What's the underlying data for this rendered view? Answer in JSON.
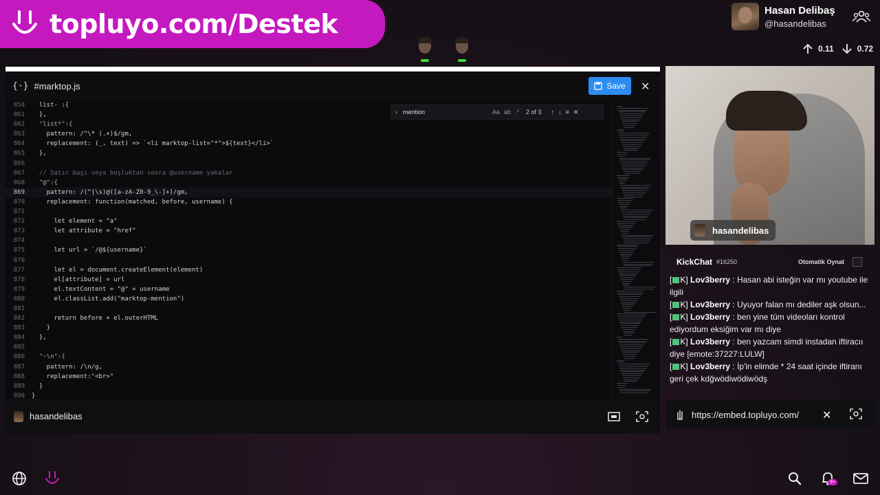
{
  "banner": {
    "text": "topluyo.com/Destek",
    "logo_icon": "topluyo-smile-logo"
  },
  "profile": {
    "name": "Hasan Delibaş",
    "handle": "@hasandelibas"
  },
  "net_stats": {
    "up": "0.11",
    "down": "0.72"
  },
  "editor": {
    "file_icon": "{·}",
    "file_name": "#marktop.js",
    "save_label": "Save",
    "close_label": "✕",
    "footer_name": "hasandelibas",
    "find": {
      "value": "mention",
      "opts": [
        "Aa",
        "ab",
        ".*"
      ],
      "count": "2 of 3"
    },
    "lines": [
      {
        "n": "858",
        "code": "  list- :{",
        "cls": "t-key"
      },
      {
        "n": "861",
        "code": "  },",
        "cls": "t-plain"
      },
      {
        "n": "862",
        "code": "  \"list*\":{",
        "cls": "t-str"
      },
      {
        "n": "863",
        "code": "    pattern: /^\\* (.+)$/gm,",
        "cls": "t-plain"
      },
      {
        "n": "864",
        "code": "    replacement: (_, text) => `<li marktop-list=\"*\">${text}</li>`",
        "cls": "t-plain"
      },
      {
        "n": "865",
        "code": "  },",
        "cls": "t-plain"
      },
      {
        "n": "866",
        "code": "",
        "cls": "t-plain"
      },
      {
        "n": "867",
        "code": "  // Satır başı veya boşluktan sonra @username yakalar",
        "cls": "t-com"
      },
      {
        "n": "868",
        "code": "  \"@\":{",
        "cls": "t-str"
      },
      {
        "n": "869",
        "code": "    pattern: /(^|\\s)@([a-zA-Z0-9_\\-]+)/gm,",
        "cls": "t-plain",
        "active": true
      },
      {
        "n": "870",
        "code": "    replacement: function(matched, before, username) {",
        "cls": "t-plain"
      },
      {
        "n": "871",
        "code": "",
        "cls": "t-plain"
      },
      {
        "n": "872",
        "code": "      let element = \"a\"",
        "cls": "t-plain"
      },
      {
        "n": "873",
        "code": "      let attribute = \"href\"",
        "cls": "t-plain"
      },
      {
        "n": "874",
        "code": "",
        "cls": "t-plain"
      },
      {
        "n": "875",
        "code": "      let url = `/@${username}`",
        "cls": "t-plain"
      },
      {
        "n": "876",
        "code": "",
        "cls": "t-plain"
      },
      {
        "n": "877",
        "code": "      let el = document.createElement(element)",
        "cls": "t-plain"
      },
      {
        "n": "878",
        "code": "      el[attribute] = url",
        "cls": "t-plain"
      },
      {
        "n": "879",
        "code": "      el.textContent = \"@\" + username",
        "cls": "t-plain"
      },
      {
        "n": "880",
        "code": "      el.classList.add(\"marktop-mention\")",
        "cls": "t-plain"
      },
      {
        "n": "881",
        "code": "",
        "cls": "t-plain"
      },
      {
        "n": "882",
        "code": "      return before + el.outerHTML",
        "cls": "t-plain"
      },
      {
        "n": "883",
        "code": "    }",
        "cls": "t-plain"
      },
      {
        "n": "884",
        "code": "  },",
        "cls": "t-plain"
      },
      {
        "n": "885",
        "code": "",
        "cls": "t-plain"
      },
      {
        "n": "886",
        "code": "  \"~\\n\":{",
        "cls": "t-str"
      },
      {
        "n": "887",
        "code": "    pattern: /\\n/g,",
        "cls": "t-plain"
      },
      {
        "n": "888",
        "code": "    replacement:\"<br>\"",
        "cls": "t-plain"
      },
      {
        "n": "889",
        "code": "  }",
        "cls": "t-plain"
      },
      {
        "n": "890",
        "code": "}",
        "cls": "t-plain"
      }
    ]
  },
  "video": {
    "label": "hasandelibas"
  },
  "chat": {
    "title": "KickChat",
    "id": "#16250",
    "autoplay_label": "Otomatik Oynat",
    "messages": [
      {
        "user": "Lov3berry",
        "text": "Hasan abi isteğin var mı youtube ile ilgili"
      },
      {
        "user": "Lov3berry",
        "text": "Uyuyor falan mı dediler aşk olsun..."
      },
      {
        "user": "Lov3berry",
        "text": "ben yine tüm videoları kontrol ediyordum eksiğim var mı diye"
      },
      {
        "user": "Lov3berry",
        "text": "ben yazcam simdi instadan iftiracıı diye [emote:37227:LULW]"
      },
      {
        "user": "Lov3berry",
        "text": "İp'in elimde * 24 saat içinde iftiranı geri çek kdğwödiwödiwödş"
      }
    ]
  },
  "embed": {
    "url": "https://embed.topluyo.com/",
    "close_label": "✕"
  },
  "bottom": {
    "notification_badge": "9+"
  }
}
